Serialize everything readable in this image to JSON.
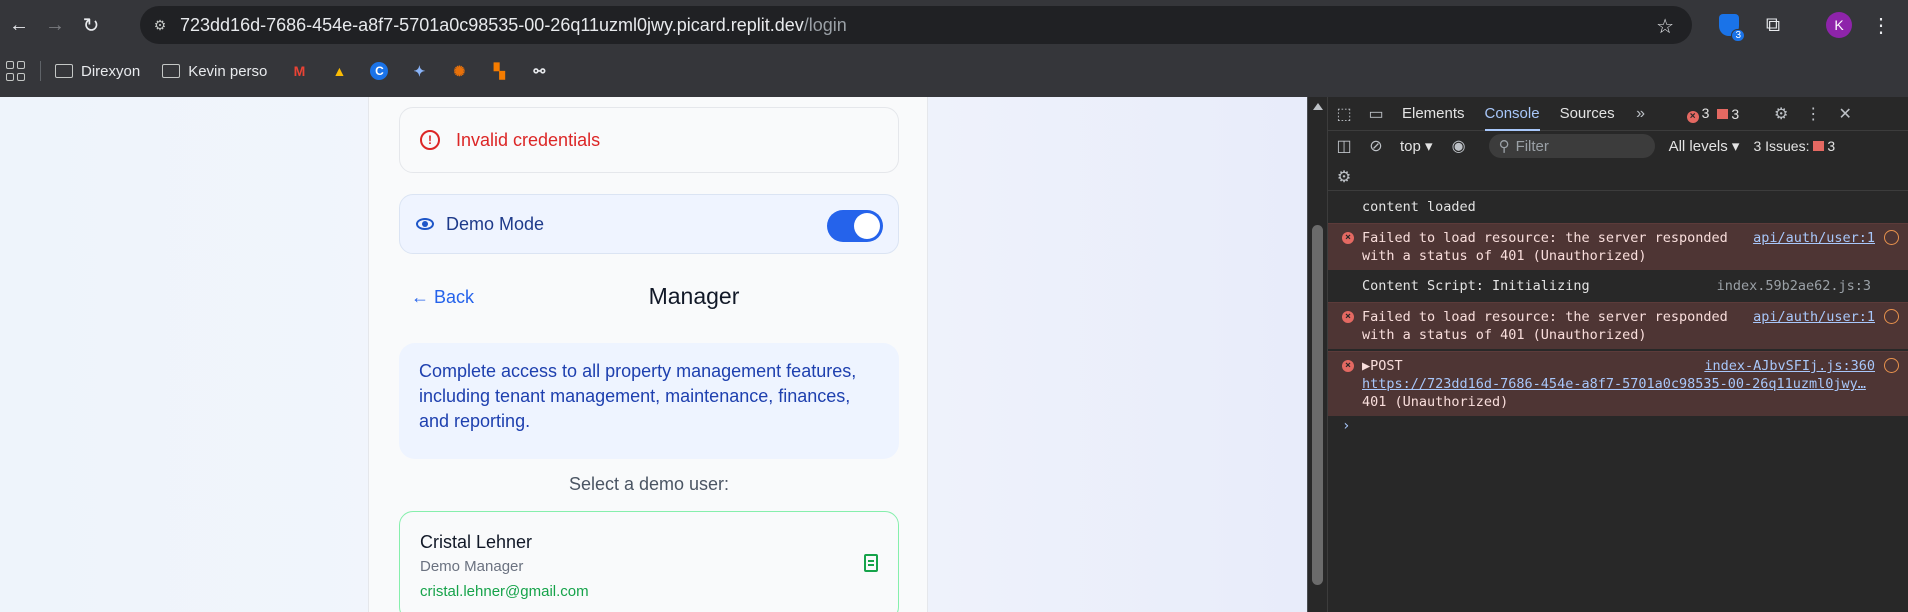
{
  "browser": {
    "url_host": "723dd16d-7686-454e-a8f7-5701a0c98535-00-26q11uzml0jwy.picard.replit.dev",
    "url_path": "/login",
    "shield_badge": "3",
    "profile_initial": "K",
    "bookmarks": [
      "Direxyon",
      "Kevin perso"
    ]
  },
  "page": {
    "alert": "Invalid credentials",
    "demo_mode_label": "Demo Mode",
    "demo_mode_on": true,
    "back_label": "← Back",
    "role_title": "Manager",
    "role_description": "Complete access to all property management features, including tenant management, maintenance, finances, and reporting.",
    "select_label": "Select a demo user:",
    "user": {
      "name": "Cristal Lehner",
      "role": "Demo Manager",
      "email": "cristal.lehner@gmail.com"
    }
  },
  "devtools": {
    "tabs": [
      "Elements",
      "Console",
      "Sources"
    ],
    "active_tab": "Console",
    "error_count": "3",
    "warning_count": "3",
    "context": "top",
    "filter_placeholder": "Filter",
    "levels": "All levels",
    "issues_label": "3 Issues:",
    "issues_count": "3",
    "logs": [
      {
        "type": "info",
        "text": "content loaded",
        "source": ""
      },
      {
        "type": "error",
        "text": "Failed to load resource: the server responded with a status of 401 (Unauthorized)",
        "source": "api/auth/user:1"
      },
      {
        "type": "info",
        "text": "Content Script: Initializing",
        "source": "index.59b2ae62.js:3"
      },
      {
        "type": "error",
        "text": "Failed to load resource: the server responded with a status of 401 (Unauthorized)",
        "source": "api/auth/user:1"
      },
      {
        "type": "error",
        "text": "▶POST",
        "link": "https://723dd16d-7686-454e-a8f7-5701a0c98535-00-26q11uzml0jwy…",
        "status": "401 (Unauthorized)",
        "source": "index-AJbvSFIj.js:360"
      }
    ]
  }
}
